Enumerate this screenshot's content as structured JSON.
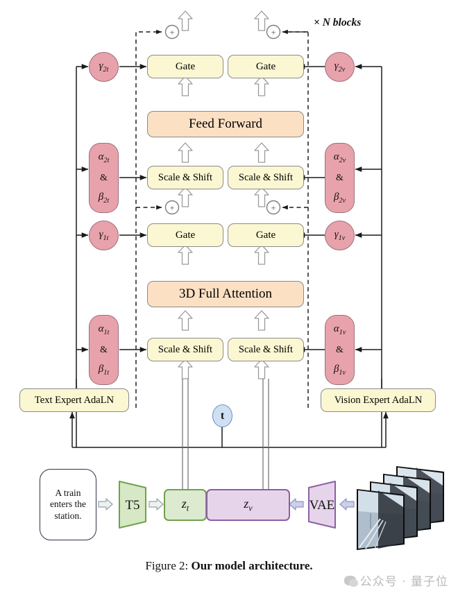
{
  "figure": {
    "caption_prefix": "Figure 2: ",
    "caption_bold": "Our model architecture.",
    "repeat_label": "× N blocks",
    "watermark": "公众号 · 量子位"
  },
  "blocks": {
    "gate_text_2": "Gate",
    "gate_vision_2": "Gate",
    "feed_forward": "Feed Forward",
    "scale_shift_text_2": "Scale & Shift",
    "scale_shift_vision_2": "Scale & Shift",
    "gate_text_1": "Gate",
    "gate_vision_1": "Gate",
    "attention": "3D Full Attention",
    "scale_shift_text_1": "Scale & Shift",
    "scale_shift_vision_1": "Scale & Shift",
    "text_expert_adaln": "Text Expert AdaLN",
    "vision_expert_adaln": "Vision Expert AdaLN"
  },
  "modulation": {
    "gamma_2t": {
      "sym": "γ",
      "sub": "2t"
    },
    "gamma_2v": {
      "sym": "γ",
      "sub": "2v"
    },
    "gamma_1t": {
      "sym": "γ",
      "sub": "1t"
    },
    "gamma_1v": {
      "sym": "γ",
      "sub": "1v"
    },
    "alpha_2t": {
      "sym": "α",
      "sub": "2t"
    },
    "beta_2t": {
      "sym": "β",
      "sub": "2t"
    },
    "alpha_2v": {
      "sym": "α",
      "sub": "2v"
    },
    "beta_2v": {
      "sym": "β",
      "sub": "2v"
    },
    "alpha_1t": {
      "sym": "α",
      "sub": "1t"
    },
    "beta_1t": {
      "sym": "β",
      "sub": "1t"
    },
    "alpha_1v": {
      "sym": "α",
      "sub": "1v"
    },
    "beta_1v": {
      "sym": "β",
      "sub": "1v"
    },
    "ampersand": "&"
  },
  "pipeline": {
    "timestep": "t",
    "prompt_text": "A train enters the station.",
    "text_encoder": "T5",
    "latent_text": {
      "sym": "z",
      "sub": "t"
    },
    "latent_vision": {
      "sym": "z",
      "sub": "v"
    },
    "video_encoder": "VAE"
  },
  "colors": {
    "gate_fill": "#fbf7d2",
    "feedforward_fill": "#fce0c4",
    "modulation_fill": "#e8a2ab",
    "timestep_fill": "#cfe0f3",
    "latent_text_fill": "#dcead0",
    "latent_text_stroke": "#6fa14a",
    "latent_vision_fill": "#e6d5ea",
    "latent_vision_stroke": "#8d5fa5",
    "stroke": "#8a8a8a"
  }
}
